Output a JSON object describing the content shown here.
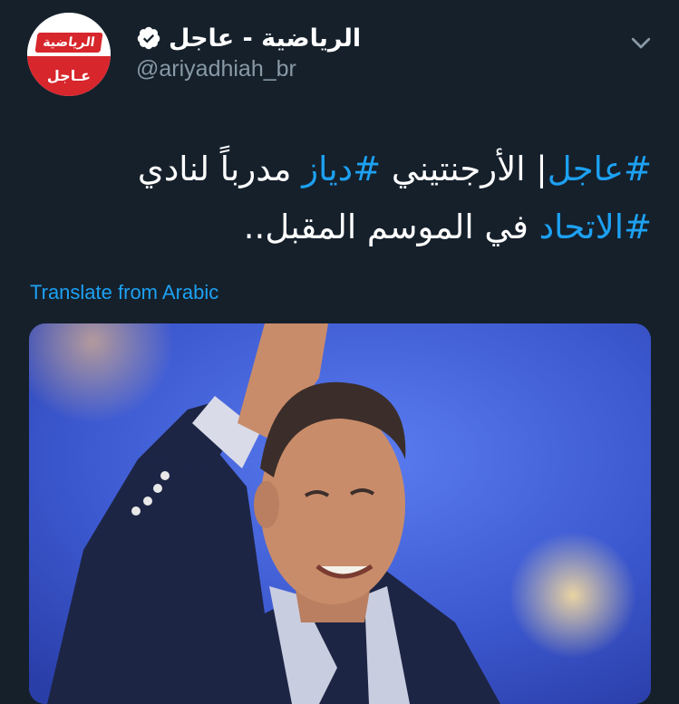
{
  "tweet": {
    "display_name": "الرياضية - عاجل",
    "handle": "@ariyadhiah_br",
    "verified_icon": "verified-badge-icon",
    "menu_icon": "chevron-down-icon",
    "avatar": {
      "logo_text": "الرياضية",
      "sub_text": "عـاجل",
      "colors": {
        "red": "#d7262c",
        "white": "#ffffff"
      }
    },
    "text": {
      "line1_parts": [
        {
          "text": "#عاجل",
          "hashtag": true
        },
        {
          "text": "| الأرجنتيني ",
          "hashtag": false
        },
        {
          "text": "#دياز",
          "hashtag": true
        },
        {
          "text": " مدرباً لنادي",
          "hashtag": false
        }
      ],
      "line2_parts": [
        {
          "text": "#الاتحاد",
          "hashtag": true
        },
        {
          "text": " في الموسم المقبل..",
          "hashtag": false
        }
      ]
    },
    "translate_label": "Translate from Arabic",
    "media": {
      "description_icon": "photo-icon"
    }
  },
  "colors": {
    "background": "#15202b",
    "text": "#ffffff",
    "secondary": "#8899a6",
    "accent": "#1da1f2"
  }
}
